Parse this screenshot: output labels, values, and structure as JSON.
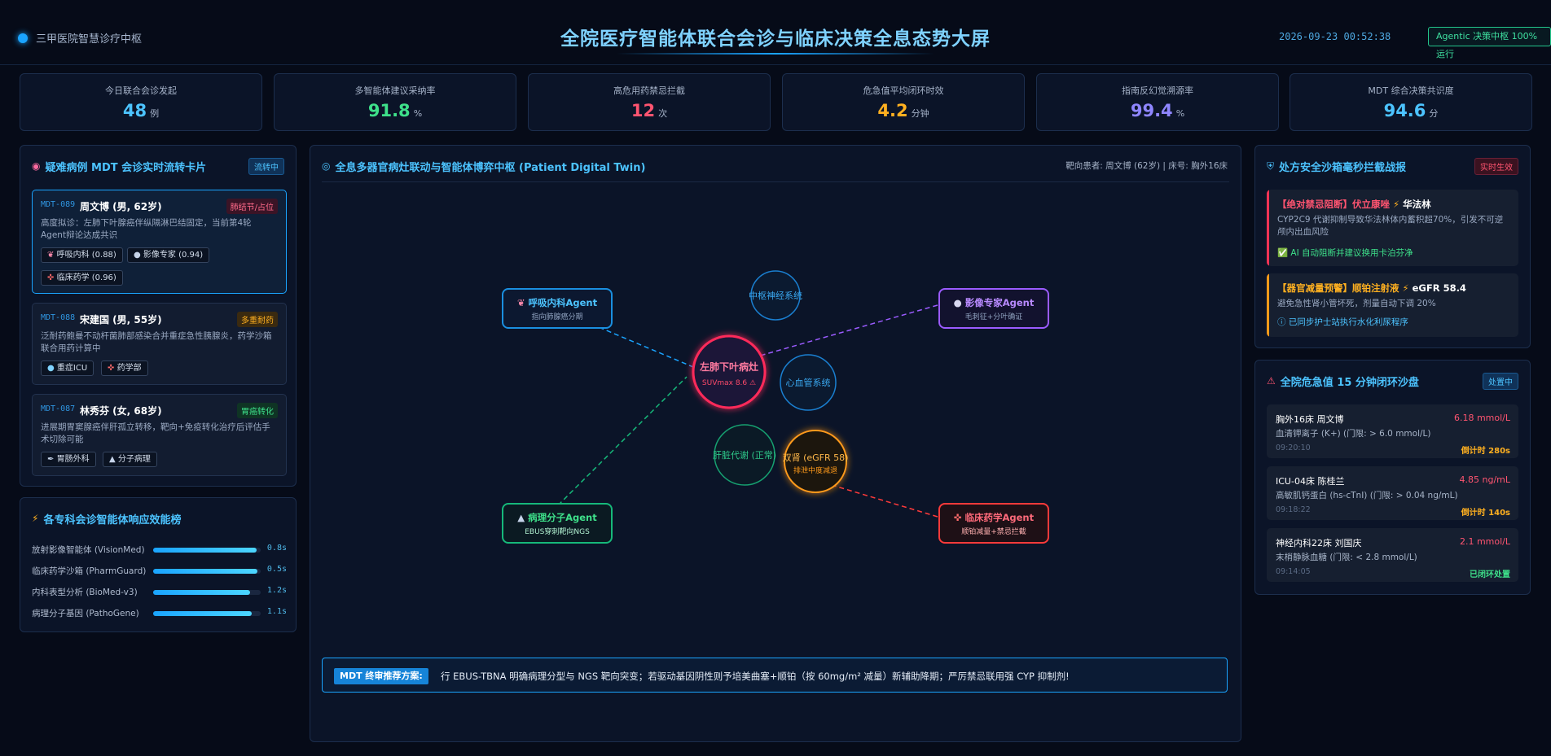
{
  "header": {
    "brand": "三甲医院智慧诊疗中枢",
    "title": "全院医疗智能体联合会诊与临床决策全息态势大屏",
    "clock": "2026-09-23 00:52:38",
    "status": "Agentic 决策中枢 100% 运行"
  },
  "kpis": [
    {
      "label": "今日联合会诊发起",
      "value": "48",
      "unit": "例",
      "color": "#4cc3ff"
    },
    {
      "label": "多智能体建议采纳率",
      "value": "91.8",
      "unit": "%",
      "color": "#3ee08a"
    },
    {
      "label": "高危用药禁忌拦截",
      "value": "12",
      "unit": "次",
      "color": "#ff5470"
    },
    {
      "label": "危急值平均闭环时效",
      "value": "4.2",
      "unit": "分钟",
      "color": "#ffb020"
    },
    {
      "label": "指南反幻觉溯源率",
      "value": "99.4",
      "unit": "%",
      "color": "#8f86ff"
    },
    {
      "label": "MDT 综合决策共识度",
      "value": "94.6",
      "unit": "分",
      "color": "#4cc3ff"
    }
  ],
  "mdt": {
    "title": "疑难病例 MDT 会诊实时流转卡片",
    "tag": "流转中",
    "cases": [
      {
        "id": "MDT-089",
        "name": "周文博 (男, 62岁)",
        "tag": "肺结节/占位",
        "desc": "高度拟诊：左肺下叶腺癌伴纵隔淋巴结固定，当前第4轮Agent辩论达成共识",
        "chips": [
          "呼吸内科 (0.88)",
          "影像专家 (0.94)",
          "临床药学 (0.96)"
        ]
      },
      {
        "id": "MDT-088",
        "name": "宋建国 (男, 55岁)",
        "tag": "多重耐药",
        "desc": "泛耐药鲍曼不动杆菌肺部感染合并重症急性胰腺炎，药学沙箱联合用药计算中",
        "chips": [
          "重症ICU",
          "药学部"
        ]
      },
      {
        "id": "MDT-087",
        "name": "林秀芬 (女, 68岁)",
        "tag": "胃癌转化",
        "desc": "进展期胃窦腺癌伴肝孤立转移，靶向+免疫转化治疗后评估手术切除可能",
        "chips": [
          "胃肠外科",
          "分子病理"
        ]
      }
    ]
  },
  "ranking": {
    "title": "各专科会诊智能体响应效能榜",
    "items": [
      {
        "label": "放射影像智能体 (VisionMed)",
        "fraction": 0.96,
        "time": "0.8s"
      },
      {
        "label": "临床药学沙箱 (PharmGuard)",
        "fraction": 0.97,
        "time": "0.5s"
      },
      {
        "label": "内科表型分析 (BioMed-v3)",
        "fraction": 0.9,
        "time": "1.2s"
      },
      {
        "label": "病理分子基因 (PathoGene)",
        "fraction": 0.92,
        "time": "1.1s"
      }
    ]
  },
  "twin": {
    "title": "全息多器官病灶联动与智能体博弈中枢 (Patient Digital Twin)",
    "patient": "靶向患者: 周文博 (62岁) | 床号: 胸外16床",
    "agents": [
      {
        "title": "呼吸内科Agent",
        "sub": "指向肺腺癌分期"
      },
      {
        "title": "影像专家Agent",
        "sub": "毛刺征+分叶确证"
      },
      {
        "title": "病理分子Agent",
        "sub": "EBUS穿刺靶向NGS"
      },
      {
        "title": "临床药学Agent",
        "sub": "顺铂减量+禁忌拦截"
      }
    ],
    "focus": {
      "title": "左肺下叶病灶",
      "sub": "SUVmax 8.6 ⚠"
    },
    "organs": {
      "neuro": "中枢神经系统",
      "cardio": "心血管系统",
      "liver": "肝脏代谢 (正常)",
      "kidney": "双肾 (eGFR 58)",
      "kidney_sub": "排泄中度减退"
    },
    "rec_tag": "MDT 终审推荐方案:",
    "rec_text": "行 EBUS-TBNA 明确病理分型与 NGS 靶向突变；若驱动基因阴性则予培美曲塞+顺铂（按 60mg/m² 减量）新辅助降期；严厉禁忌联用强 CYP 抑制剂!"
  },
  "sandbox": {
    "title": "处方安全沙箱毫秒拦截战报",
    "tag": "实时生效",
    "alerts": [
      {
        "title_a": "【绝对禁忌阻断】伏立康唑",
        "title_b": "华法林",
        "desc": "CYP2C9 代谢抑制导致华法林体内蓄积超70%，引发不可逆颅内出血风险",
        "action": "AI 自动阻断并建议换用卡泊芬净",
        "color": "#ff3355"
      },
      {
        "title_a": "【器官减量预警】顺铂注射液",
        "title_b": "eGFR 58.4",
        "desc": "避免急性肾小管坏死，剂量自动下调 20%",
        "action": "已同步护士站执行水化利尿程序",
        "color": "#ff9a1a"
      }
    ]
  },
  "critical": {
    "title": "全院危急值 15 分钟闭环沙盘",
    "tag": "处置中",
    "items": [
      {
        "name": "胸外16床 周文博",
        "value": "6.18 mmol/L",
        "desc": "血清钾离子 (K+) (门限: > 6.0 mmol/L)",
        "time": "09:20:10",
        "countdown": "倒计时 280s",
        "cd_color": "#ffb020"
      },
      {
        "name": "ICU-04床 陈桂兰",
        "value": "4.85 ng/mL",
        "desc": "高敏肌钙蛋白 (hs-cTnI) (门限: > 0.04 ng/mL)",
        "time": "09:18:22",
        "countdown": "倒计时 140s",
        "cd_color": "#ffb020"
      },
      {
        "name": "神经内科22床 刘国庆",
        "value": "2.1 mmol/L",
        "desc": "末梢静脉血糖 (门限: < 2.8 mmol/L)",
        "time": "09:14:05",
        "countdown": "已闭环处置",
        "cd_color": "#3ee08a"
      }
    ]
  }
}
